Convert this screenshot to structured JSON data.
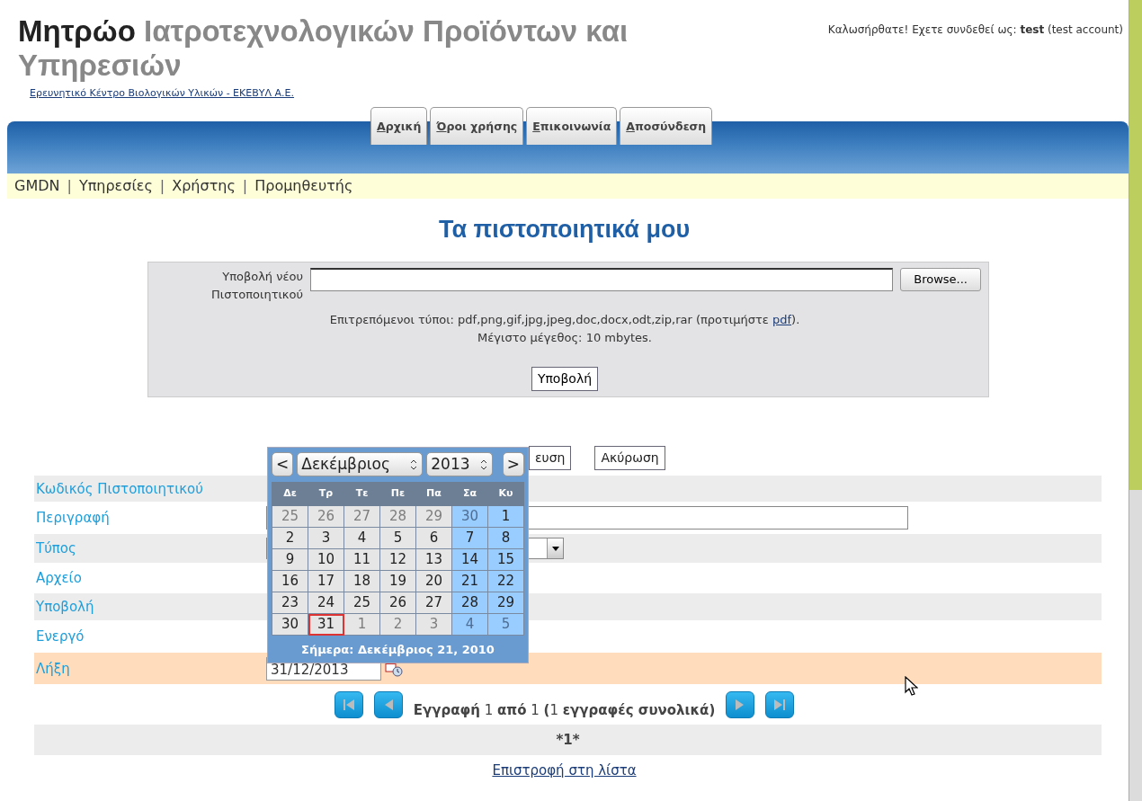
{
  "header": {
    "title_main": "Μητρώο",
    "title_rest": "Ιατροτεχνολογικών Προϊόντων και Υπηρεσιών",
    "organization_link": "Ερευνητικό Κέντρο Βιολογικών Υλικών - ΕΚΕΒΥΛ Α.Ε.",
    "welcome": "Καλωσήρθατε! Εχετε συνδεθεί ως: **test** (test account)"
  },
  "tabs": [
    {
      "label": "Αρχική"
    },
    {
      "label": "Όροι χρήσης"
    },
    {
      "label": "Επικοινωνία"
    },
    {
      "label": "Αποσύνδεση"
    }
  ],
  "subnav": [
    {
      "kind": "link",
      "text": "GMDN"
    },
    {
      "kind": "separator",
      "text": "|"
    },
    {
      "kind": "link",
      "text": "Υπηρεσίες"
    },
    {
      "kind": "separator",
      "text": "|"
    },
    {
      "kind": "link",
      "text": "Χρήστης"
    },
    {
      "kind": "separator",
      "text": "|"
    },
    {
      "kind": "link",
      "text": "Προμηθευτής"
    }
  ],
  "page_title": "Τα πιστοποιητικά μου",
  "upload": {
    "label": "Υποβολή νέου Πιστοποιητικού",
    "browse_button": "Browse...",
    "allowed_types": "Επιτρεπόμενοι τύποι: pdf,png,gif,jpg,jpeg,doc,docx,odt,zip,rar (προτιμήστε ",
    "preferred_link": "pdf",
    "allowed_types_end": ").",
    "max_size": "Μέγιστο μέγεθος: 10 mbytes.",
    "submit_button": "Υποβολή"
  },
  "form_buttons": [
    "ευση",
    "Ακύρωση"
  ],
  "fields": [
    {
      "label": "Κωδικός Πιστοποιητικού",
      "kind": "text",
      "selected": false
    },
    {
      "label": "Περιγραφή",
      "kind": "input",
      "selected": false
    },
    {
      "label": "Τύπος",
      "kind": "select",
      "selected": false
    },
    {
      "label": "Αρχείο",
      "kind": "text",
      "selected": false
    },
    {
      "label": "Υποβολή",
      "kind": "text",
      "selected": false
    },
    {
      "label": "Ενεργό",
      "kind": "text",
      "selected": false
    },
    {
      "label": "Λήξη",
      "kind": "date",
      "value": "31/12/2013",
      "selected": true
    }
  ],
  "calendar": {
    "prev": "<",
    "month": "Δεκέμβριος",
    "year": "2013",
    "next": ">",
    "weekdays": [
      "Δε",
      "Τρ",
      "Τε",
      "Πε",
      "Πα",
      "Σα",
      "Κυ"
    ],
    "weeks": [
      [
        {
          "day": "25",
          "muted": true,
          "selected": false
        },
        {
          "day": "26",
          "muted": true,
          "selected": false
        },
        {
          "day": "27",
          "muted": true,
          "selected": false
        },
        {
          "day": "28",
          "muted": true,
          "selected": false
        },
        {
          "day": "29",
          "muted": true,
          "selected": false
        },
        {
          "day": "30",
          "muted": true,
          "selected": false
        },
        {
          "day": "1",
          "muted": false,
          "selected": false
        }
      ],
      [
        {
          "day": "2",
          "muted": false,
          "selected": false
        },
        {
          "day": "3",
          "muted": false,
          "selected": false
        },
        {
          "day": "4",
          "muted": false,
          "selected": false
        },
        {
          "day": "5",
          "muted": false,
          "selected": false
        },
        {
          "day": "6",
          "muted": false,
          "selected": false
        },
        {
          "day": "7",
          "muted": false,
          "selected": false
        },
        {
          "day": "8",
          "muted": false,
          "selected": false
        }
      ],
      [
        {
          "day": "9",
          "muted": false,
          "selected": false
        },
        {
          "day": "10",
          "muted": false,
          "selected": false
        },
        {
          "day": "11",
          "muted": false,
          "selected": false
        },
        {
          "day": "12",
          "muted": false,
          "selected": false
        },
        {
          "day": "13",
          "muted": false,
          "selected": false
        },
        {
          "day": "14",
          "muted": false,
          "selected": false
        },
        {
          "day": "15",
          "muted": false,
          "selected": false
        }
      ],
      [
        {
          "day": "16",
          "muted": false,
          "selected": false
        },
        {
          "day": "17",
          "muted": false,
          "selected": false
        },
        {
          "day": "18",
          "muted": false,
          "selected": false
        },
        {
          "day": "19",
          "muted": false,
          "selected": false
        },
        {
          "day": "20",
          "muted": false,
          "selected": false
        },
        {
          "day": "21",
          "muted": false,
          "selected": false
        },
        {
          "day": "22",
          "muted": false,
          "selected": false
        }
      ],
      [
        {
          "day": "23",
          "muted": false,
          "selected": false
        },
        {
          "day": "24",
          "muted": false,
          "selected": false
        },
        {
          "day": "25",
          "muted": false,
          "selected": false
        },
        {
          "day": "26",
          "muted": false,
          "selected": false
        },
        {
          "day": "27",
          "muted": false,
          "selected": false
        },
        {
          "day": "28",
          "muted": false,
          "selected": false
        },
        {
          "day": "29",
          "muted": false,
          "selected": false
        }
      ],
      [
        {
          "day": "30",
          "muted": false,
          "selected": false
        },
        {
          "day": "31",
          "muted": false,
          "selected": true
        },
        {
          "day": "1",
          "muted": true,
          "selected": false
        },
        {
          "day": "2",
          "muted": true,
          "selected": false
        },
        {
          "day": "3",
          "muted": true,
          "selected": false
        },
        {
          "day": "4",
          "muted": true,
          "selected": false
        },
        {
          "day": "5",
          "muted": true,
          "selected": false
        }
      ]
    ],
    "today": "Σήμερα: Δεκέμβριος 21, 2010"
  },
  "pager": {
    "text": "**Εγγραφή** 1 **από** 1 **(**1 **εγγραφές συνολικά)**"
  },
  "page_marker": "*1*",
  "back_link": "Επιστροφή στη λίστα"
}
